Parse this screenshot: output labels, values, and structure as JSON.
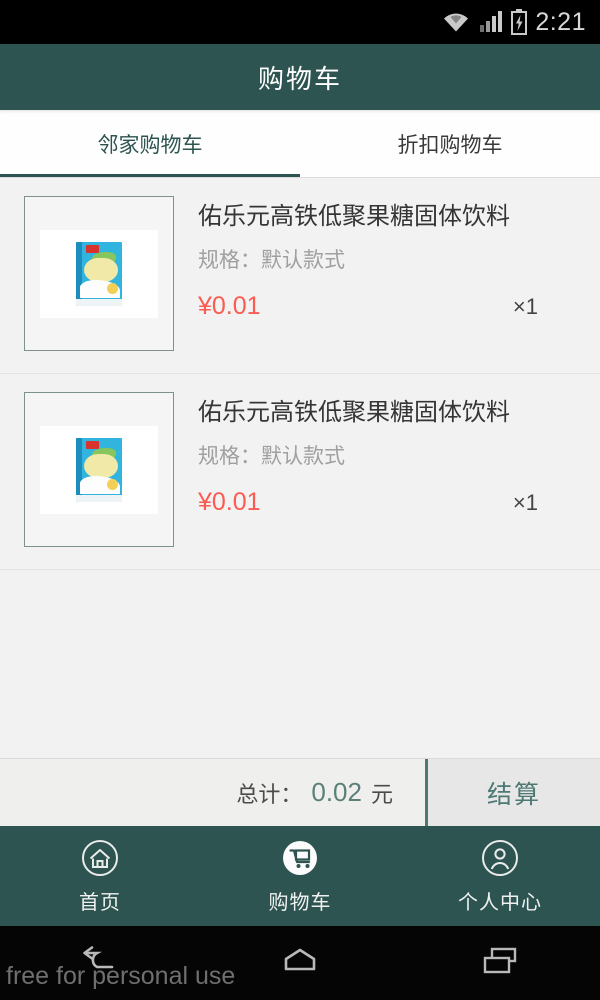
{
  "statusbar": {
    "time": "2:21",
    "icons": [
      "wifi-icon",
      "cellular-signal-icon",
      "battery-charging-icon"
    ]
  },
  "header": {
    "title": "购物车",
    "bg_color": "#2d5450"
  },
  "tabs": [
    {
      "label": "邻家购物车",
      "active": true,
      "color": "#2d5450"
    },
    {
      "label": "折扣购物车",
      "active": false,
      "color": "#3a3a3a"
    }
  ],
  "cart": {
    "items": [
      {
        "name": "佑乐元高铁低聚果糖固体饮料",
        "spec": "规格：默认款式",
        "price": "¥0.01",
        "qty": "×1",
        "thumbnail": "product-package-thumbnail"
      },
      {
        "name": "佑乐元高铁低聚果糖固体饮料",
        "spec": "规格：默认款式",
        "price": "¥0.01",
        "qty": "×1",
        "thumbnail": "product-package-thumbnail"
      }
    ]
  },
  "total_bar": {
    "total_label": "总计：",
    "total_value": "0.02",
    "total_unit": "元",
    "checkout_label": "结算",
    "accent_color": "#4e7873"
  },
  "bottom_nav": [
    {
      "label": "首页",
      "icon": "home-icon",
      "active": false
    },
    {
      "label": "购物车",
      "icon": "shopping-cart-icon",
      "active": true
    },
    {
      "label": "个人中心",
      "icon": "person-icon",
      "active": false
    }
  ],
  "system_nav": {
    "back": "back-icon",
    "home": "home-icon",
    "recents": "recents-icon"
  },
  "watermark": "free for personal use",
  "colors": {
    "brand_teal": "#2d5450",
    "price_red": "#fc5b51",
    "total_teal": "#5c7f79",
    "page_bg": "#f1f2f1"
  }
}
